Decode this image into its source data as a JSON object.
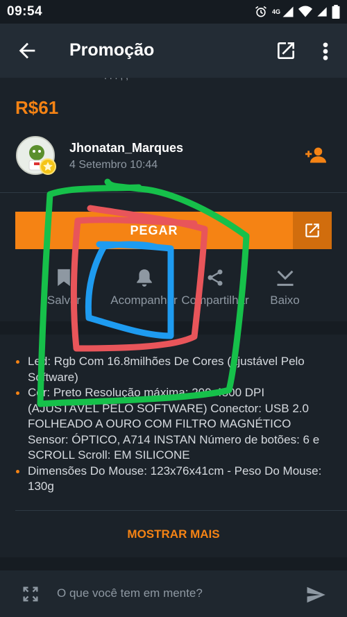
{
  "status_bar": {
    "time": "09:54",
    "network": "4G",
    "icons": [
      "alarm-icon",
      "signal-icon",
      "wifi-icon",
      "battery-icon"
    ]
  },
  "app_bar": {
    "title": "Promoção",
    "back_icon": "arrow-left-icon",
    "open_external_icon": "open-in-new-icon",
    "more_icon": "more-vertical-icon"
  },
  "deal": {
    "price": "R$61"
  },
  "author": {
    "name": "Jhonatan_Marques",
    "posted": "4 Setembro 10:44",
    "follow_icon": "add-person-icon"
  },
  "cta": {
    "label": "PEGAR",
    "open_icon": "open-in-new-icon"
  },
  "actions": [
    {
      "label": "Salvar",
      "icon": "bookmark-icon"
    },
    {
      "label": "Acompanhar",
      "icon": "bell-icon"
    },
    {
      "label": "Compartilhar",
      "icon": "share-icon"
    },
    {
      "label": "Baixo",
      "icon": "download-icon"
    }
  ],
  "description": [
    "Led: Rgb Com 16.8milhões De Cores (ajustável Pelo Software)",
    "Cor: Preto Resolução máxima: 200-4800 DPI (AJUSTÁVEL PELO SOFTWARE) Conector: USB 2.0 FOLHEADO A OURO COM FILTRO MAGNÉTICO Sensor: ÓPTICO, A714 INSTAN Número de botões: 6 e SCROLL Scroll: EM SILICONE",
    "Dimensões Do Mouse: 123x76x41cm - Peso Do Mouse: 130g"
  ],
  "show_more": "MOSTRAR MAIS",
  "composer": {
    "placeholder": "O que você tem em mente?",
    "expand_icon": "fullscreen-icon",
    "send_icon": "send-icon"
  },
  "colors": {
    "accent": "#f58314",
    "background": "#1b2229",
    "app_bar": "#232c35",
    "annotation_green": "#16c04a",
    "annotation_red": "#e8555a",
    "annotation_blue": "#1e9bf0"
  }
}
